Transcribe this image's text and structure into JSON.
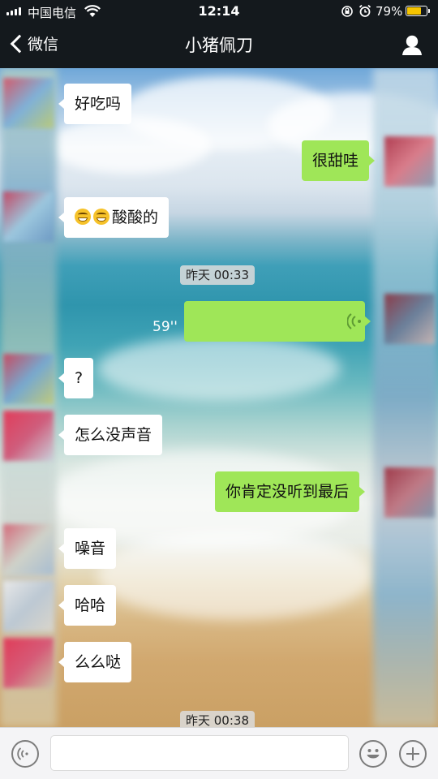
{
  "status_bar": {
    "carrier": "中国电信",
    "time": "12:14",
    "battery_percent": "79%",
    "battery_level": 0.79,
    "icons": [
      "signal-icon",
      "wifi-icon",
      "orientation-lock-icon",
      "alarm-icon",
      "battery-icon"
    ]
  },
  "nav": {
    "back_label": "微信",
    "title": "小猪佩刀",
    "profile_icon": "person-icon"
  },
  "messages": [
    {
      "side": "in",
      "text": "好吃吗"
    },
    {
      "side": "out",
      "text": "很甜哇"
    },
    {
      "side": "in",
      "emoji_count": 2,
      "text": "酸酸的"
    },
    {
      "type": "timestamp",
      "text": "昨天 00:33"
    },
    {
      "side": "out",
      "type": "voice",
      "duration": "59''"
    },
    {
      "side": "in",
      "text": "?"
    },
    {
      "side": "in",
      "text": "怎么没声音"
    },
    {
      "side": "out",
      "text": "你肯定没听到最后"
    },
    {
      "side": "in",
      "text": "噪音"
    },
    {
      "side": "in",
      "text": "哈哈"
    },
    {
      "side": "in",
      "text": "么么哒"
    },
    {
      "type": "timestamp",
      "text": "昨天 00:38"
    }
  ],
  "input_bar": {
    "value": "",
    "icons": [
      "voice-toggle-icon",
      "emoji-icon",
      "plus-icon"
    ]
  },
  "colors": {
    "outgoing_bubble": "#9fe658",
    "incoming_bubble": "#ffffff",
    "header": "#14191d",
    "battery": "#f5c400"
  }
}
